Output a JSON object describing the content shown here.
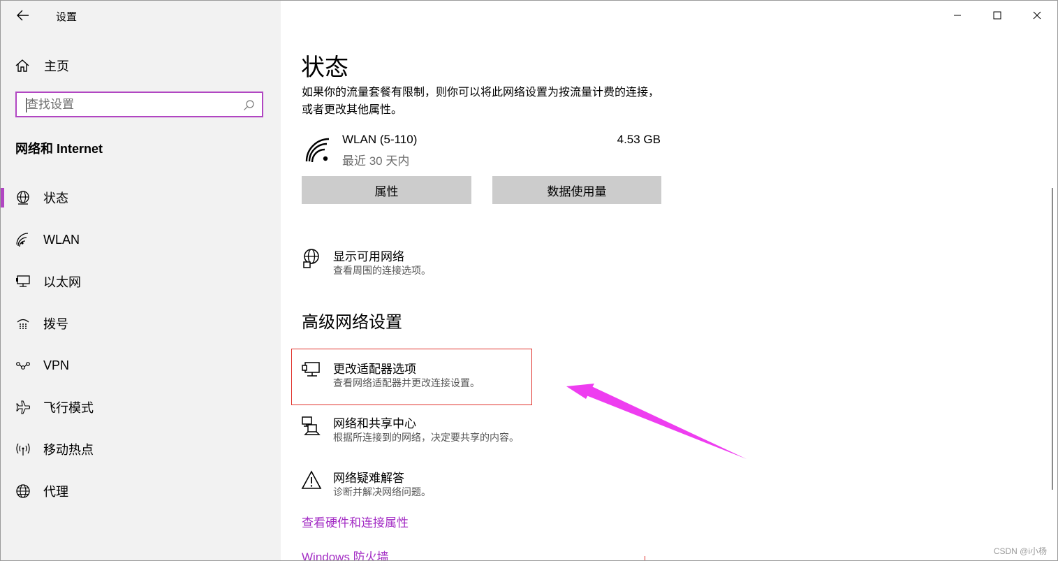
{
  "window": {
    "title": "设置",
    "controls": {
      "minimize": "minimize-icon",
      "maximize": "maximize-icon",
      "close": "close-icon"
    }
  },
  "sidebar": {
    "home_label": "主页",
    "search_placeholder": "查找设置",
    "section_title": "网络和 Internet",
    "items": [
      {
        "label": "状态",
        "icon": "globe-status-icon",
        "selected": true
      },
      {
        "label": "WLAN",
        "icon": "wifi-icon",
        "selected": false
      },
      {
        "label": "以太网",
        "icon": "ethernet-icon",
        "selected": false
      },
      {
        "label": "拨号",
        "icon": "dialup-icon",
        "selected": false
      },
      {
        "label": "VPN",
        "icon": "vpn-icon",
        "selected": false
      },
      {
        "label": "飞行模式",
        "icon": "airplane-icon",
        "selected": false
      },
      {
        "label": "移动热点",
        "icon": "hotspot-icon",
        "selected": false
      },
      {
        "label": "代理",
        "icon": "globe-icon",
        "selected": false
      }
    ]
  },
  "main": {
    "title": "状态",
    "description": "如果你的流量套餐有限制，则你可以将此网络设置为按流量计费的连接，或者更改其他属性。",
    "network": {
      "name": "WLAN (5-110)",
      "period": "最近 30 天内",
      "usage": "4.53 GB"
    },
    "buttons": {
      "properties": "属性",
      "data_usage": "数据使用量"
    },
    "show_networks": {
      "title": "显示可用网络",
      "subtitle": "查看周围的连接选项。"
    },
    "advanced_title": "高级网络设置",
    "advanced_items": [
      {
        "title": "更改适配器选项",
        "subtitle": "查看网络适配器并更改连接设置。",
        "icon": "adapter-icon"
      },
      {
        "title": "网络和共享中心",
        "subtitle": "根据所连接到的网络，决定要共享的内容。",
        "icon": "sharing-center-icon"
      },
      {
        "title": "网络疑难解答",
        "subtitle": "诊断并解决网络问题。",
        "icon": "warning-icon"
      }
    ],
    "links": {
      "hardware": "查看硬件和连接属性",
      "firewall": "Windows 防火墙"
    }
  },
  "overlay": {
    "watermark": "CSDN @i小杨"
  },
  "colors": {
    "accent": "#b146c2",
    "link": "#a32cc4",
    "highlight_box": "#e0322c",
    "annotation_arrow": "#ee3df0",
    "sidebar_bg": "#f2f2f2",
    "button_bg": "#cccccc"
  }
}
